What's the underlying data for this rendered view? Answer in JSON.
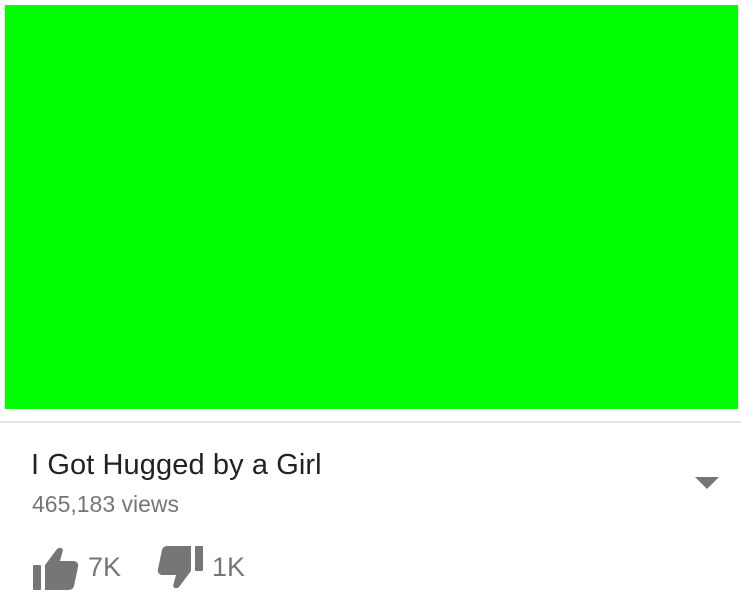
{
  "player": {
    "background_color": "#00ff00"
  },
  "video": {
    "title": "I Got Hugged by a Girl",
    "views": "465,183 views",
    "expand_icon": "triangle-down-icon"
  },
  "actions": {
    "like": {
      "icon": "thumbs-up-icon",
      "count": "7K"
    },
    "dislike": {
      "icon": "thumbs-down-icon",
      "count": "1K"
    }
  },
  "colors": {
    "title_text": "#222222",
    "secondary_text": "#767676",
    "icon": "#767676",
    "divider": "#e5e5e5"
  }
}
